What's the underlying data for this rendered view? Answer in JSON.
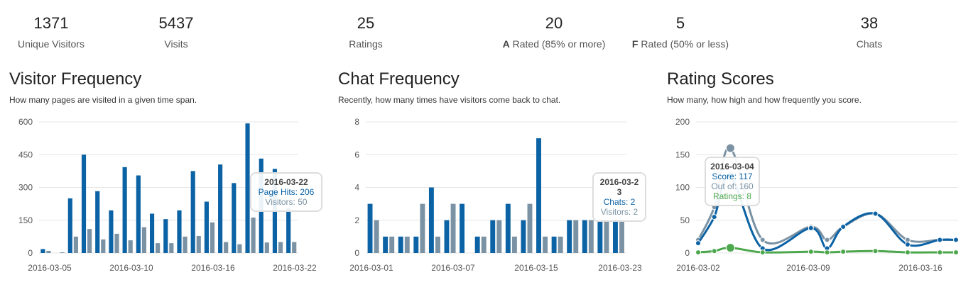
{
  "stats": [
    {
      "value": "1371",
      "label": "Unique Visitors",
      "bold": ""
    },
    {
      "value": "5437",
      "label": "Visits",
      "bold": ""
    },
    {
      "value": "25",
      "label": "Ratings",
      "bold": ""
    },
    {
      "value": "20",
      "label": " Rated (85% or more)",
      "bold": "A"
    },
    {
      "value": "5",
      "label": " Rated (50% or less)",
      "bold": "F"
    },
    {
      "value": "38",
      "label": "Chats",
      "bold": ""
    }
  ],
  "panels": {
    "visitor": {
      "title": "Visitor Frequency",
      "subtitle": "How many pages are visited in a given time span."
    },
    "chat": {
      "title": "Chat Frequency",
      "subtitle": "Recently, how many times have visitors come back to chat."
    },
    "rating": {
      "title": "Rating Scores",
      "subtitle": "How many, how high and how frequently you score."
    }
  },
  "colors": {
    "blue": "#0b62a4",
    "gray": "#7a92a3",
    "green": "#4da74d",
    "grid": "#e6e6e6"
  },
  "tooltips": {
    "visitor": {
      "title": "2016-03-22",
      "line1": "Page Hits: 206",
      "line2": "Visitors: 50"
    },
    "chat": {
      "title": "2016-03-23",
      "line1": "Chats: 2",
      "line2": "Visitors: 2"
    },
    "rating": {
      "title": "2016-03-04",
      "line1": "Score: 117",
      "line2": "Out of: 160",
      "line3": "Ratings: 8"
    }
  },
  "chart_data": [
    {
      "type": "bar",
      "title": "Visitor Frequency",
      "ylim": [
        0,
        600
      ],
      "yticks": [
        0,
        150,
        300,
        450,
        600
      ],
      "xticks": [
        "2016-03-05",
        "2016-03-10",
        "2016-03-16",
        "2016-03-22"
      ],
      "series": [
        {
          "name": "Page Hits",
          "values": [
            18,
            0,
            250,
            450,
            283,
            195,
            393,
            355,
            180,
            155,
            195,
            375,
            235,
            405,
            320,
            593,
            432,
            385,
            206
          ]
        },
        {
          "name": "Visitors",
          "values": [
            10,
            3,
            75,
            110,
            62,
            88,
            58,
            118,
            45,
            45,
            75,
            78,
            140,
            50,
            40,
            162,
            48,
            50,
            50
          ]
        }
      ]
    },
    {
      "type": "bar",
      "title": "Chat Frequency",
      "ylim": [
        0,
        8
      ],
      "yticks": [
        0,
        2,
        4,
        6,
        8
      ],
      "xticks": [
        "2016-03-01",
        "2016-03-07",
        "2016-03-15",
        "2016-03-23"
      ],
      "series": [
        {
          "name": "Chats",
          "values": [
            3,
            1,
            1,
            1,
            4,
            2,
            3,
            1,
            2,
            3,
            2,
            7,
            1,
            2,
            2,
            2,
            2
          ]
        },
        {
          "name": "Visitors",
          "values": [
            2,
            1,
            1,
            3,
            1,
            3,
            0,
            1,
            2,
            1,
            3,
            1,
            1,
            2,
            2,
            2,
            2
          ]
        }
      ]
    },
    {
      "type": "line",
      "title": "Rating Scores",
      "ylim": [
        0,
        200
      ],
      "yticks": [
        0,
        50,
        100,
        150,
        200
      ],
      "xticks": [
        "2016-03-02",
        "2016-03-09",
        "2016-03-16"
      ],
      "x": [
        "2016-03-02",
        "2016-03-03",
        "2016-03-04",
        "2016-03-06",
        "2016-03-09",
        "2016-03-10",
        "2016-03-11",
        "2016-03-13",
        "2016-03-15",
        "2016-03-17",
        "2016-03-18"
      ],
      "series": [
        {
          "name": "Score",
          "values": [
            15,
            55,
            117,
            7,
            38,
            7,
            40,
            60,
            13,
            20,
            20
          ]
        },
        {
          "name": "Out of",
          "values": [
            20,
            70,
            160,
            20,
            40,
            20,
            40,
            60,
            20,
            20,
            20
          ]
        },
        {
          "name": "Ratings",
          "values": [
            1,
            3,
            8,
            1,
            2,
            1,
            2,
            3,
            1,
            1,
            1
          ]
        }
      ]
    }
  ]
}
